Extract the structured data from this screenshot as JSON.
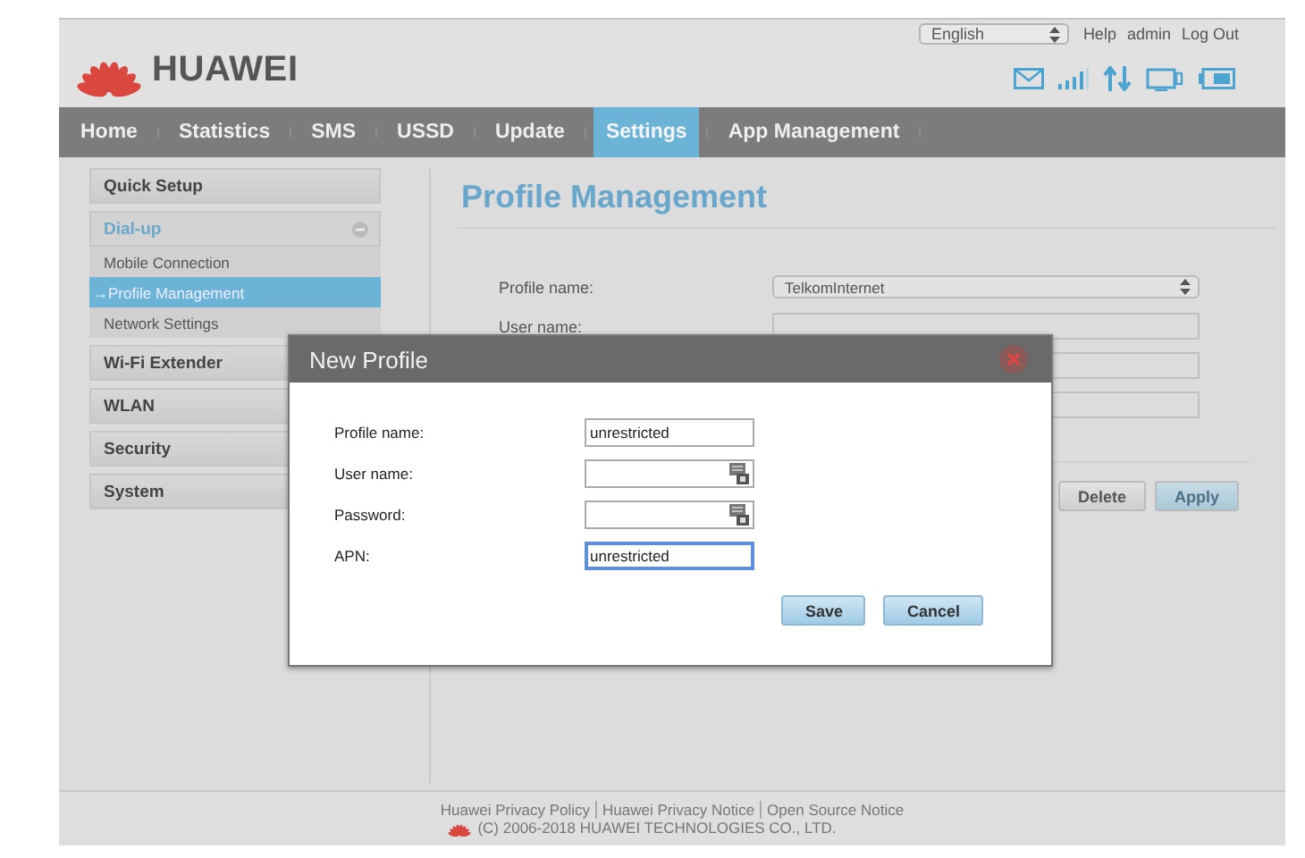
{
  "header": {
    "brand": "HUAWEI",
    "language": "English",
    "links": [
      "Help",
      "admin",
      "Log Out"
    ]
  },
  "nav": [
    {
      "label": "Home",
      "selected": false
    },
    {
      "label": "Statistics",
      "selected": false
    },
    {
      "label": "SMS",
      "selected": false
    },
    {
      "label": "USSD",
      "selected": false
    },
    {
      "label": "Update",
      "selected": false
    },
    {
      "label": "Settings",
      "selected": true
    },
    {
      "label": "App Management",
      "selected": false
    }
  ],
  "sidebar": [
    {
      "label": "Quick Setup",
      "expanded": false
    },
    {
      "label": "Dial-up",
      "expanded": true,
      "children": [
        {
          "label": "Mobile Connection",
          "selected": false
        },
        {
          "label": "→Profile Management",
          "selected": true
        },
        {
          "label": "Network Settings",
          "selected": false
        }
      ]
    },
    {
      "label": "Wi-Fi Extender",
      "expanded": false
    },
    {
      "label": "WLAN",
      "expanded": false
    },
    {
      "label": "Security",
      "expanded": false
    },
    {
      "label": "System",
      "expanded": false
    }
  ],
  "page": {
    "title": "Profile Management",
    "rows": [
      {
        "label": "Profile name:",
        "value": "TelkomInternet",
        "kind": "select"
      },
      {
        "label": "User name:",
        "kind": "text"
      },
      {
        "kind": "text"
      },
      {
        "kind": "text"
      }
    ],
    "buttons": [
      "Delete",
      "Apply"
    ]
  },
  "dialog": {
    "title": "New Profile",
    "fields": [
      {
        "label": "Profile name:",
        "value": "unrestricted",
        "kind": "text",
        "focused": false
      },
      {
        "label": "User name:",
        "kind": "keypad",
        "focused": false
      },
      {
        "label": "Password:",
        "kind": "keypad",
        "focused": false
      },
      {
        "label": "APN:",
        "value": "unrestricted",
        "kind": "text",
        "focused": true
      }
    ],
    "buttons": [
      "Save",
      "Cancel"
    ]
  },
  "footer": {
    "links": [
      "Huawei Privacy Policy",
      "Huawei Privacy Notice",
      "Open Source Notice"
    ],
    "copyright": "(C) 2006-2018 HUAWEI TECHNOLOGIES CO., LTD."
  }
}
